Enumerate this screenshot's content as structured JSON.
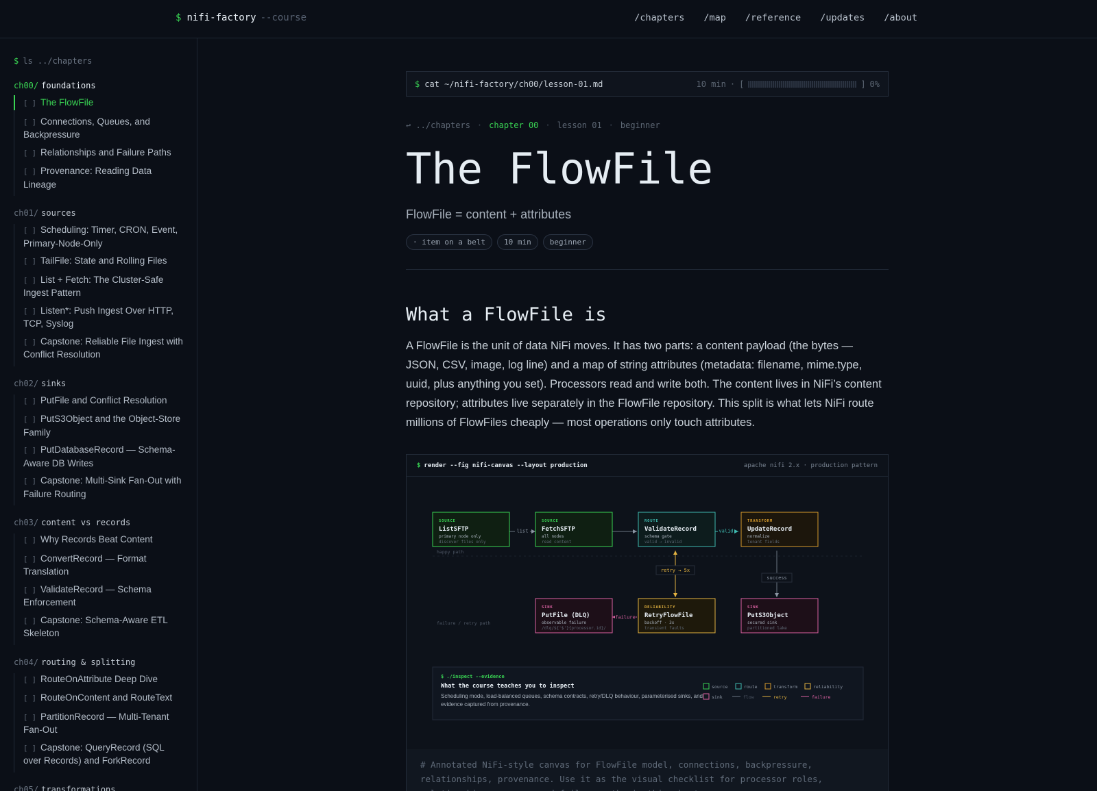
{
  "brand": {
    "prompt": "$",
    "name": "nifi-factory",
    "flag": "--course"
  },
  "nav": [
    "/chapters",
    "/map",
    "/reference",
    "/updates",
    "/about"
  ],
  "sidebar": {
    "prompt": "$",
    "command": "ls ../chapters",
    "chapters": [
      {
        "num": "ch00/",
        "title": "foundations",
        "lessons": [
          "The FlowFile",
          "Connections, Queues, and Backpressure",
          "Relationships and Failure Paths",
          "Provenance: Reading Data Lineage"
        ]
      },
      {
        "num": "ch01/",
        "title": "sources",
        "lessons": [
          "Scheduling: Timer, CRON, Event, Primary-Node-Only",
          "TailFile: State and Rolling Files",
          "List + Fetch: The Cluster-Safe Ingest Pattern",
          "Listen*: Push Ingest Over HTTP, TCP, Syslog",
          "Capstone: Reliable File Ingest with Conflict Resolution"
        ]
      },
      {
        "num": "ch02/",
        "title": "sinks",
        "lessons": [
          "PutFile and Conflict Resolution",
          "PutS3Object and the Object-Store Family",
          "PutDatabaseRecord — Schema-Aware DB Writes",
          "Capstone: Multi-Sink Fan-Out with Failure Routing"
        ]
      },
      {
        "num": "ch03/",
        "title": "content vs records",
        "lessons": [
          "Why Records Beat Content",
          "ConvertRecord — Format Translation",
          "ValidateRecord — Schema Enforcement",
          "Capstone: Schema-Aware ETL Skeleton"
        ]
      },
      {
        "num": "ch04/",
        "title": "routing & splitting",
        "lessons": [
          "RouteOnAttribute Deep Dive",
          "RouteOnContent and RouteText",
          "PartitionRecord — Multi-Tenant Fan-Out",
          "Capstone: QueryRecord (SQL over Records) and ForkRecord"
        ]
      },
      {
        "num": "ch05/",
        "title": "transformations",
        "lessons": []
      }
    ],
    "checkbox": "[ ]"
  },
  "catbar": {
    "prompt": "$",
    "command": "cat ~/nifi-factory/ch00/lesson-01.md",
    "duration": "10 min",
    "dot": "·",
    "bracket_open": "[",
    "bracket_close": "]",
    "progress": 0,
    "progress_label": "0%"
  },
  "crumbs": {
    "back": "↩ ../chapters",
    "chapter": "chapter 00",
    "lesson": "lesson 01",
    "level": "beginner",
    "sep": "·"
  },
  "lesson": {
    "title": "The FlowFile",
    "subtitle": "FlowFile = content + attributes",
    "tags": [
      "· item on a belt",
      "10 min",
      "beginner"
    ],
    "section_title": "What a FlowFile is",
    "paragraph": "A FlowFile is the unit of data NiFi moves. It has two parts: a content payload (the bytes — JSON, CSV, image, log line) and a map of string attributes (metadata: filename, mime.type, uuid, plus anything you set). Processors read and write both. The content lives in NiFi’s content repository; attributes live separately in the FlowFile repository. This split is what lets NiFi route millions of FlowFiles cheaply — most operations only touch attributes."
  },
  "figure": {
    "prompt": "$",
    "command": "render --fig nifi-canvas --layout production",
    "right": "apache nifi 2.x · production pattern",
    "colors": {
      "source": "#39d353",
      "route": "#3fb9b0",
      "transform": "#d69a2d",
      "reliability": "#e3b341",
      "sink": "#db61a2",
      "flow": "#6b7583"
    },
    "nodes": [
      {
        "id": "list",
        "kind": "SOURCE",
        "name": "ListSFTP",
        "l1": "primary node only",
        "l2": "discover files only"
      },
      {
        "id": "fetch",
        "kind": "SOURCE",
        "name": "FetchSFTP",
        "l1": "all nodes",
        "l2": "read content"
      },
      {
        "id": "validate",
        "kind": "ROUTE",
        "name": "ValidateRecord",
        "l1": "schema gate",
        "l2": "valid → invalid"
      },
      {
        "id": "update",
        "kind": "TRANSFORM",
        "name": "UpdateRecord",
        "l1": "normalize",
        "l2": "tenant fields"
      },
      {
        "id": "putfile",
        "kind": "SINK",
        "name": "PutFile (DLQ)",
        "l1": "observable failure",
        "l2": "/dlq/${'$'}{processor.id}/"
      },
      {
        "id": "retry",
        "kind": "RELIABILITY",
        "name": "RetryFlowFile",
        "l1": "backoff · 3x",
        "l2": "transient faults"
      },
      {
        "id": "puts3",
        "kind": "SINK",
        "name": "PutS3Object",
        "l1": "secured sink",
        "l2": "partitioned lake"
      }
    ],
    "edge_labels": {
      "list": "list",
      "valid": "valid",
      "retry": "retry → 5x",
      "success": "success",
      "failure": "failure"
    },
    "lane_labels": {
      "happy": "happy path",
      "failure": "failure / retry path"
    },
    "inspect": {
      "prompt": "$ ./inspect --evidence",
      "heading": "What the course teaches you to inspect",
      "body": "Scheduling mode, load-balanced queues, schema contracts, retry/DLQ behaviour, parameterised sinks, and evidence captured from provenance."
    },
    "legend": {
      "source": "source",
      "route": "route",
      "transform": "transform",
      "reliability": "reliability",
      "sink": "sink",
      "flow": "flow",
      "retry": "retry",
      "failure": "failure"
    },
    "caption": "# Annotated NiFi-style canvas for FlowFile model, connections, backpressure, relationships, provenance. Use it as the visual checklist for processor roles, relationships, queues, and failure paths in this chapter."
  }
}
